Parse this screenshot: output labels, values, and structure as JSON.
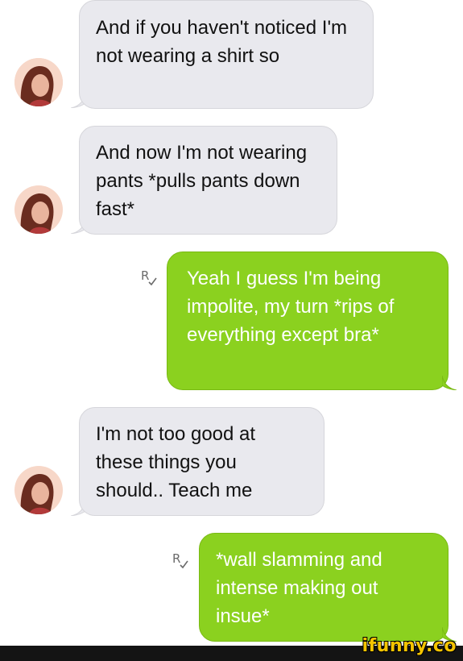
{
  "conversation": {
    "messages": [
      {
        "direction": "incoming",
        "text": "And if you haven't noticed I'm not wearing a shirt so"
      },
      {
        "direction": "incoming",
        "text": "And now I'm not wearing pants *pulls pants down fast*"
      },
      {
        "direction": "outgoing",
        "text": "Yeah I guess I'm being impolite, my turn *rips of everything except bra*",
        "receipt_icon": "read-receipt-icon"
      },
      {
        "direction": "incoming",
        "text": "I'm not too good at these things you should.. Teach me"
      },
      {
        "direction": "outgoing",
        "text": "*wall slamming and intense making out insue*",
        "receipt_icon": "read-receipt-icon"
      }
    ]
  },
  "watermark": {
    "text": "ifunny.co"
  },
  "colors": {
    "incoming_bubble": "#e9e9ee",
    "outgoing_bubble": "#8bd11f",
    "outgoing_text": "#ffffff",
    "watermark": "#f5c400",
    "footer": "#141414"
  }
}
